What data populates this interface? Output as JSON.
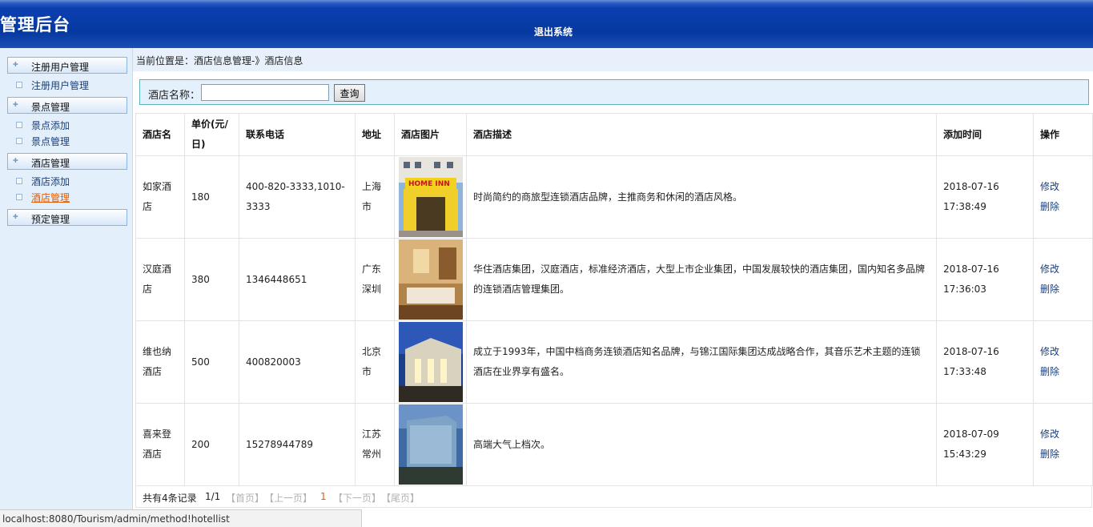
{
  "header": {
    "title": "管理后台",
    "logout": "退出系统"
  },
  "sidebar": {
    "groups": [
      {
        "label": "注册用户管理",
        "items": [
          "注册用户管理"
        ]
      },
      {
        "label": "景点管理",
        "items": [
          "景点添加",
          "景点管理"
        ]
      },
      {
        "label": "酒店管理",
        "items": [
          "酒店添加",
          "酒店管理"
        ]
      },
      {
        "label": "预定管理",
        "items": []
      }
    ],
    "active_item": "酒店管理"
  },
  "breadcrumb": "当前位置是：酒店信息管理-》酒店信息",
  "search": {
    "label": "酒店名称：",
    "value": "",
    "button": "查询"
  },
  "table": {
    "headers": [
      "酒店名",
      "单价(元/日)",
      "联系电话",
      "地址",
      "酒店图片",
      "酒店描述",
      "添加时间",
      "操作"
    ],
    "rows": [
      {
        "name": "如家酒店",
        "price": "180",
        "phone": "400-820-3333,1010-3333",
        "address": "上海市",
        "image": "hotel-photo-homeinn",
        "desc": "时尚简约的商旅型连锁酒店品牌，主推商务和休闲的酒店风格。",
        "date": "2018-07-16",
        "time": "17:38:49",
        "edit": "修改",
        "delete": "删除"
      },
      {
        "name": "汉庭酒店",
        "price": "380",
        "phone": "1346448651",
        "address": "广东深圳",
        "image": "hotel-photo-hanting",
        "desc": "华住酒店集团，汉庭酒店，标准经济酒店，大型上市企业集团，中国发展较快的酒店集团，国内知名多品牌的连锁酒店管理集团。",
        "date": "2018-07-16",
        "time": "17:36:03",
        "edit": "修改",
        "delete": "删除"
      },
      {
        "name": "维也纳酒店",
        "price": "500",
        "phone": "400820003",
        "address": "北京市",
        "image": "hotel-photo-vienna",
        "desc": "成立于1993年，中国中档商务连锁酒店知名品牌，与锦江国际集团达成战略合作，其音乐艺术主题的连锁酒店在业界享有盛名。",
        "date": "2018-07-16",
        "time": "17:33:48",
        "edit": "修改",
        "delete": "删除"
      },
      {
        "name": "喜来登酒店",
        "price": "200",
        "phone": "15278944789",
        "address": "江苏常州",
        "image": "hotel-photo-sheraton",
        "desc": "高端大气上档次。",
        "date": "2018-07-09",
        "time": "15:43:29",
        "edit": "修改",
        "delete": "删除"
      }
    ]
  },
  "pager": {
    "total": "共有4条记录",
    "page": "1/1",
    "first": "【首页】",
    "prev": "【上一页】",
    "current": "1",
    "next": "【下一页】",
    "last": "【尾页】"
  },
  "statusbar": "localhost:8080/Tourism/admin/method!hotellist"
}
